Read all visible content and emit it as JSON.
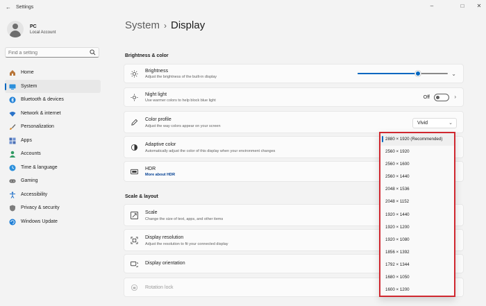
{
  "window": {
    "title": "Settings"
  },
  "user": {
    "name": "PC",
    "account": "Local Account"
  },
  "search": {
    "placeholder": "Find a setting"
  },
  "nav": [
    {
      "label": "Home",
      "icon": "home-icon"
    },
    {
      "label": "System",
      "icon": "system-icon"
    },
    {
      "label": "Bluetooth & devices",
      "icon": "bluetooth-icon"
    },
    {
      "label": "Network & internet",
      "icon": "wifi-icon"
    },
    {
      "label": "Personalization",
      "icon": "brush-icon"
    },
    {
      "label": "Apps",
      "icon": "apps-icon"
    },
    {
      "label": "Accounts",
      "icon": "accounts-icon"
    },
    {
      "label": "Time & language",
      "icon": "globe-clock-icon"
    },
    {
      "label": "Gaming",
      "icon": "gamepad-icon"
    },
    {
      "label": "Accessibility",
      "icon": "accessibility-icon"
    },
    {
      "label": "Privacy & security",
      "icon": "shield-icon"
    },
    {
      "label": "Windows Update",
      "icon": "update-icon"
    }
  ],
  "nav_active": "System",
  "breadcrumb": {
    "parent": "System",
    "separator": "›",
    "current": "Display"
  },
  "sections": {
    "brightness": "Brightness & color",
    "scale": "Scale & layout"
  },
  "cards": {
    "brightness": {
      "title": "Brightness",
      "desc": "Adjust the brightness of the built-in display",
      "level": 0.67
    },
    "night_light": {
      "title": "Night light",
      "desc": "Use warmer colors to help block blue light",
      "state": "Off"
    },
    "color_profile": {
      "title": "Color profile",
      "desc": "Adjust the way colors appear on your screen",
      "value": "Vivid"
    },
    "adaptive_color": {
      "title": "Adaptive color",
      "desc": "Automatically adjust the color of this display when your environment changes"
    },
    "hdr": {
      "title": "HDR",
      "link": "More about HDR"
    },
    "scale": {
      "title": "Scale",
      "desc": "Change the size of text, apps, and other items"
    },
    "display_resolution": {
      "title": "Display resolution",
      "desc": "Adjust the resolution to fit your connected display"
    },
    "display_orientation": {
      "title": "Display orientation"
    },
    "rotation_lock": {
      "title": "Rotation lock"
    }
  },
  "resolution_options": [
    "2880 × 1920 (Recommended)",
    "2560 × 1920",
    "2560 × 1600",
    "2560 × 1440",
    "2048 × 1536",
    "2048 × 1152",
    "1920 × 1440",
    "1920 × 1200",
    "1920 × 1080",
    "1856 × 1392",
    "1792 × 1344",
    "1680 × 1050",
    "1600 × 1200"
  ],
  "resolution_selected": 0,
  "colors": {
    "accent": "#0067c0",
    "highlight_border": "#d0272f"
  }
}
